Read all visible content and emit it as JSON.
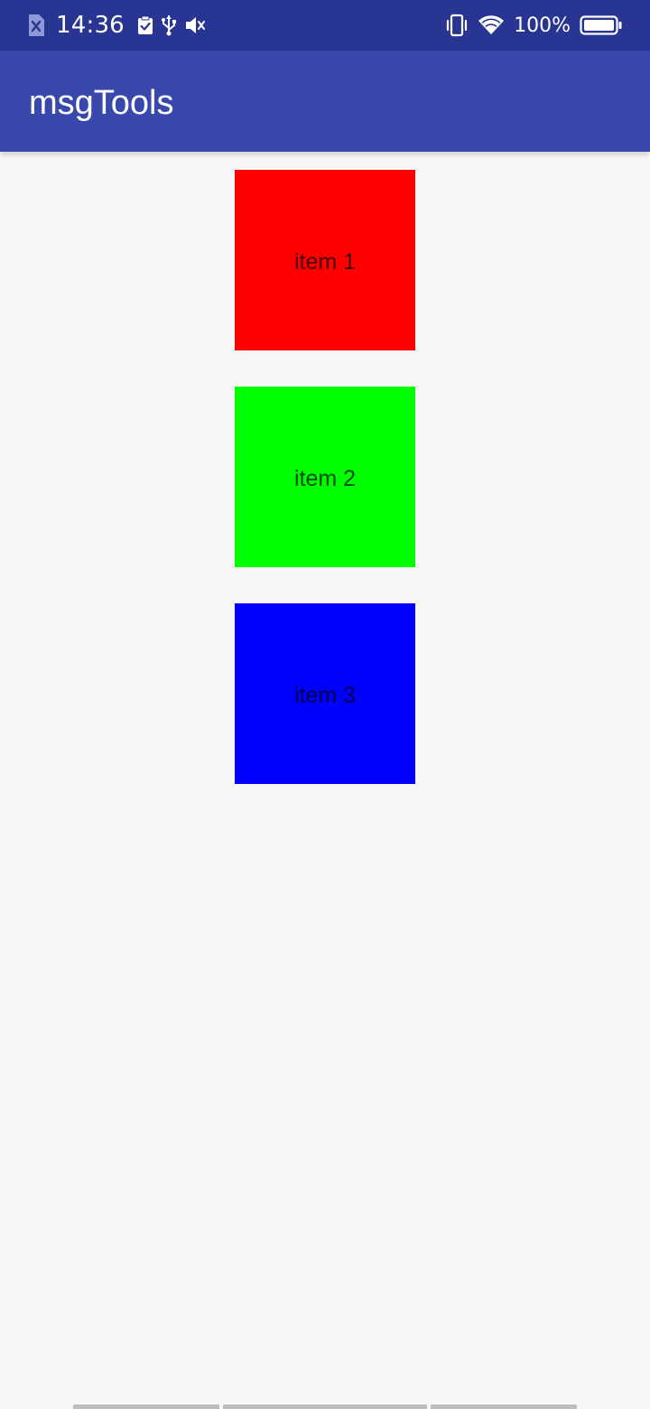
{
  "status_bar": {
    "time": "14:36",
    "battery_text": "100%",
    "icons": {
      "left": [
        "sim-off-icon",
        "clipboard-check-icon",
        "usb-icon",
        "volume-mute-icon"
      ],
      "right": [
        "vibrate-icon",
        "wifi-icon",
        "battery-icon"
      ]
    }
  },
  "app_bar": {
    "title": "msgTools"
  },
  "items": [
    {
      "label": "item 1",
      "color": "#ff0000"
    },
    {
      "label": "item 2",
      "color": "#00ff00"
    },
    {
      "label": "item 3",
      "color": "#0000ff"
    }
  ],
  "colors": {
    "status_bar": "#283593",
    "app_bar": "#3949ab",
    "background": "#f7f7f7"
  }
}
